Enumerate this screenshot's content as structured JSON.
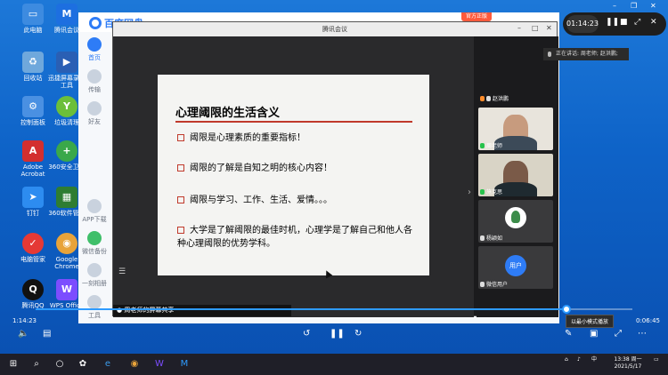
{
  "desktop": {
    "icons": [
      {
        "label": "此电脑",
        "icon": "computer-icon",
        "color": "#3d8be0"
      },
      {
        "label": "腾讯会议",
        "icon": "meeting-icon",
        "color": "#1d6fe0"
      },
      {
        "label": "回收站",
        "icon": "recycle-bin-icon",
        "color": "#6fa8dc"
      },
      {
        "label": "迅捷屏幕录像工具",
        "icon": "recorder-icon",
        "color": "#2a5fb4"
      },
      {
        "label": "控制面板",
        "icon": "control-panel-icon",
        "color": "#4a90e2"
      },
      {
        "label": "垃圾清理",
        "icon": "cleanup-icon",
        "color": "#6cbf3a"
      },
      {
        "label": "Adobe Acrobat",
        "icon": "acrobat-icon",
        "color": "#d32f2f"
      },
      {
        "label": "360安全卫士",
        "icon": "shield-icon",
        "color": "#3aa84a"
      },
      {
        "label": "钉钉",
        "icon": "dingtalk-icon",
        "color": "#2d8cf0"
      },
      {
        "label": "360软件管家",
        "icon": "software-icon",
        "color": "#2e7d32"
      },
      {
        "label": "电脑管家",
        "icon": "pc-manager-icon",
        "color": "#e53935"
      },
      {
        "label": "Google Chrome",
        "icon": "chrome-icon",
        "color": "#e8a33a"
      },
      {
        "label": "腾讯QQ",
        "icon": "qq-icon",
        "color": "#111111"
      },
      {
        "label": "WPS Office",
        "icon": "wps-icon",
        "color": "#7c4dff"
      }
    ]
  },
  "baidu": {
    "title": "百度网盘",
    "vip_badge": "官方正版",
    "sidebar": [
      {
        "label": "首页",
        "active": true
      },
      {
        "label": "传输"
      },
      {
        "label": "好友"
      },
      {
        "label": "APP下载"
      },
      {
        "label": "微信备份"
      },
      {
        "label": "一刻相册"
      },
      {
        "label": "工具"
      }
    ]
  },
  "meeting": {
    "title": "腾讯会议",
    "slide": {
      "title": "心理阈限的生活含义",
      "bullets": [
        "阈限是心理素质的重要指标！",
        "阈限的了解是自知之明的核心内容！",
        "阈限与学习、工作、生活、爱情。。。",
        "大学是了解阈限的最佳时机，心理学是了解自己和他人各种心理阈限的优势学科。"
      ]
    },
    "share_caption": "周老师的屏幕共享",
    "participants": [
      {
        "name": "赵洪鹏",
        "type": "name-only"
      },
      {
        "name": "周老师",
        "type": "video"
      },
      {
        "name": "施克思",
        "type": "video"
      },
      {
        "name": "杨颖如",
        "type": "avatar"
      },
      {
        "name": "微信用户",
        "type": "user",
        "badge": "用户"
      }
    ]
  },
  "float": {
    "time": "01:14:23",
    "speaking": "正在讲话: 周老师; 赵洪鹏;"
  },
  "player": {
    "elapsed": "1:14:23",
    "total": "0:06:45",
    "progress": 0.89,
    "mini_tip": "以最小模式播放"
  },
  "taskbar": {
    "time": "13:38 周一",
    "date": "2021/5/17"
  }
}
